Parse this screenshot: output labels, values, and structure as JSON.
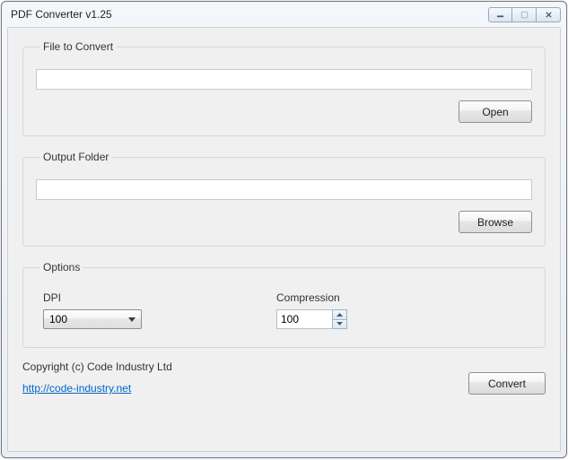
{
  "window": {
    "title": "PDF Converter v1.25"
  },
  "groups": {
    "file": {
      "legend": "File to Convert",
      "value": "",
      "button": "Open"
    },
    "output": {
      "legend": "Output Folder",
      "value": "",
      "button": "Browse"
    },
    "options": {
      "legend": "Options",
      "dpi_label": "DPI",
      "dpi_value": "100",
      "compression_label": "Compression",
      "compression_value": "100"
    }
  },
  "footer": {
    "copyright": "Copyright (c) Code Industry Ltd",
    "link_text": "http://code-industry.net",
    "convert": "Convert"
  }
}
